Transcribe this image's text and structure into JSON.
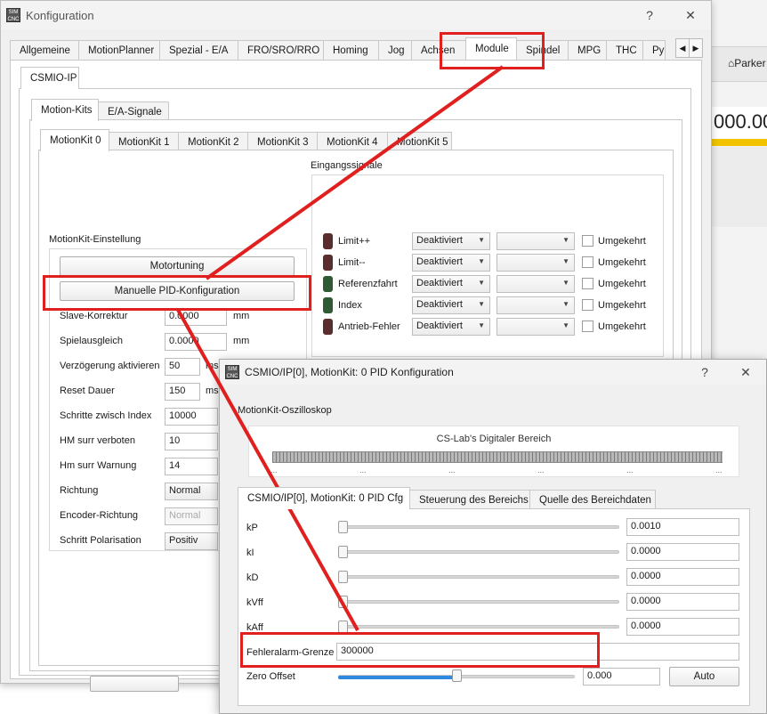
{
  "background_app": {
    "park_label": "Parker",
    "value_fragment": "000.00"
  },
  "config_window": {
    "title": "Konfiguration",
    "help": "?",
    "close": "✕",
    "tabs": [
      "Allgemeine",
      "MotionPlanner",
      "Spezial - E/A",
      "FRO/SRO/RRO",
      "Homing",
      "Jog",
      "Achsen",
      "Module",
      "Spindel",
      "MPG",
      "THC",
      "Py"
    ],
    "active_tab": "Module",
    "scroll_left": "◀",
    "scroll_right": "▶",
    "module_tab": "CSMIO-IP",
    "sub_tabs": [
      "Motion-Kits",
      "E/A-Signale"
    ],
    "motionkit_tabs": [
      "MotionKit 0",
      "MotionKit 1",
      "MotionKit 2",
      "MotionKit 3",
      "MotionKit 4",
      "MotionKit 5"
    ],
    "eingangssignale_title": "Eingangssignale",
    "signals": [
      {
        "name": "Limit++",
        "mode": "Deaktiviert",
        "inverted_label": "Umgekehrt"
      },
      {
        "name": "Limit--",
        "mode": "Deaktiviert",
        "inverted_label": "Umgekehrt"
      },
      {
        "name": "Referenzfahrt",
        "mode": "Deaktiviert",
        "inverted_label": "Umgekehrt"
      },
      {
        "name": "Index",
        "mode": "Deaktiviert",
        "inverted_label": "Umgekehrt"
      },
      {
        "name": "Antrieb-Fehler",
        "mode": "Deaktiviert",
        "inverted_label": "Umgekehrt"
      }
    ],
    "settings_title": "MotionKit-Einstellung",
    "motortuning_button": "Motortuning",
    "pid_button": "Manuelle PID-Konfiguration",
    "settings": [
      {
        "label": "Slave-Korrektur",
        "value": "0.0000",
        "unit": "mm"
      },
      {
        "label": "Spielausgleich",
        "value": "0.0000",
        "unit": "mm"
      },
      {
        "label": "Verzögerung aktivieren",
        "value": "50",
        "unit": "ms"
      },
      {
        "label": "Reset Dauer",
        "value": "150",
        "unit": "ms"
      },
      {
        "label": "Schritte zwisch Index",
        "value": "10000",
        "unit": ""
      },
      {
        "label": "HM surr verboten",
        "value": "10",
        "unit": ""
      },
      {
        "label": "Hm surr Warnung",
        "value": "14",
        "unit": ""
      },
      {
        "label": "Richtung",
        "value": "Normal",
        "unit": ""
      },
      {
        "label": "Encoder-Richtung",
        "value": "Normal",
        "unit": ""
      },
      {
        "label": "Schritt Polarisation",
        "value": "Positiv",
        "unit": ""
      }
    ]
  },
  "pid_window": {
    "title": "CSMIO/IP[0], MotionKit: 0 PID Konfiguration",
    "help": "?",
    "close": "✕",
    "oscilloscope_label": "MotionKit-Oszilloskop",
    "scope_title": "CS-Lab's Digitaler Bereich",
    "scope_dots": "...",
    "tabs": [
      "CSMIO/IP[0], MotionKit: 0 PID Cfg",
      "Steuerung des Bereichs",
      "Quelle des Bereichdaten"
    ],
    "params": [
      {
        "label": "kP",
        "value": "0.0010",
        "slider": 0.0
      },
      {
        "label": "kI",
        "value": "0.0000",
        "slider": 0.0
      },
      {
        "label": "kD",
        "value": "0.0000",
        "slider": 0.0
      },
      {
        "label": "kVff",
        "value": "0.0000",
        "slider": 0.0
      },
      {
        "label": "kAff",
        "value": "0.0000",
        "slider": 0.0
      }
    ],
    "fehler_label": "Fehleralarm-Grenze",
    "fehler_value": "300000",
    "zero_label": "Zero Offset",
    "zero_value": "0.000",
    "zero_slider": 0.5,
    "auto_button": "Auto"
  },
  "colors": {
    "annotation": "#e0201f",
    "led_red": "#5a2d2d",
    "led_green": "#2f5a33",
    "slider_fill": "#2d8ae0"
  }
}
